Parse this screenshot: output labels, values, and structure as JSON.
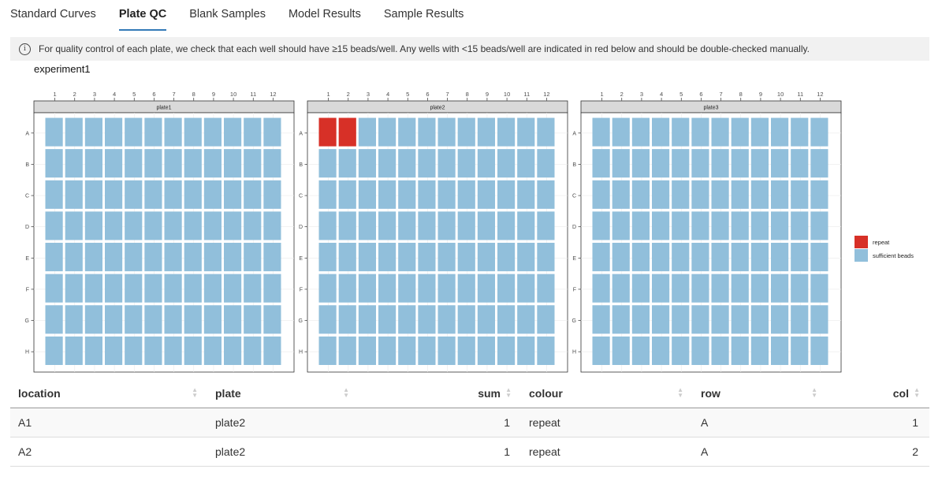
{
  "tabs": [
    {
      "label": "Standard Curves"
    },
    {
      "label": "Plate QC"
    },
    {
      "label": "Blank Samples"
    },
    {
      "label": "Model Results"
    },
    {
      "label": "Sample Results"
    }
  ],
  "active_tab": "Plate QC",
  "info": {
    "icon": "info-circle-icon",
    "text": "For quality control of each plate, we check that each well should have ≥15 beads/well. Any wells with <15 beads/well are indicated in red below and should be double-checked manually."
  },
  "chart_data": {
    "type": "heatmap",
    "title": "experiment1",
    "panels": [
      "plate1",
      "plate2",
      "plate3"
    ],
    "columns": [
      "1",
      "2",
      "3",
      "4",
      "5",
      "6",
      "7",
      "8",
      "9",
      "10",
      "11",
      "12"
    ],
    "rows": [
      "A",
      "B",
      "C",
      "D",
      "E",
      "F",
      "G",
      "H"
    ],
    "categories": [
      "repeat",
      "sufficient beads"
    ],
    "colors": {
      "repeat": "#d73027",
      "sufficient beads": "#91bfdb"
    },
    "repeat_wells": [
      {
        "plate": "plate2",
        "row": "A",
        "col": 1
      },
      {
        "plate": "plate2",
        "row": "A",
        "col": 2
      }
    ],
    "default_category": "sufficient beads",
    "legend_position": "right"
  },
  "table": {
    "headers": [
      "location",
      "plate",
      "sum",
      "colour",
      "row",
      "col"
    ],
    "rows": [
      {
        "location": "A1",
        "plate": "plate2",
        "sum": "1",
        "colour": "repeat",
        "row": "A",
        "col": "1"
      },
      {
        "location": "A2",
        "plate": "plate2",
        "sum": "1",
        "colour": "repeat",
        "row": "A",
        "col": "2"
      }
    ]
  }
}
